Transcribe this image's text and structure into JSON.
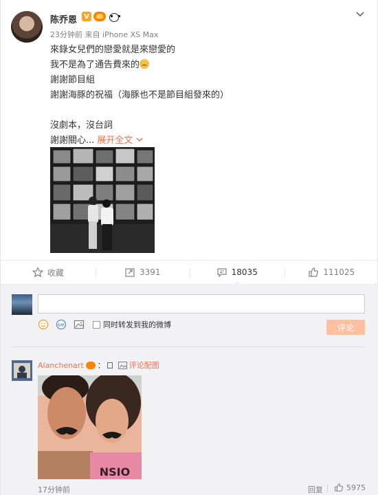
{
  "post": {
    "username": "陈乔恩",
    "verified_badge": "V",
    "timestamp": "23分钟前",
    "source_prefix": "来自",
    "source": "iPhone XS Max",
    "lines": [
      "來錄女兒們的戀愛就是來戀愛的",
      "我不是為了通告費來的",
      "謝謝節目組",
      "謝謝海豚的祝福（海豚也不是節目組發來的）",
      "",
      "沒劇本，沒台詞",
      "謝謝關心..."
    ],
    "expand_label": "展开全文",
    "icons": {
      "more": "chevron-down-icon",
      "verified": "verified-v-icon",
      "vip": "vip-crown-icon",
      "extra": "panda-icon",
      "emoji": "sad-face-emoji-icon"
    }
  },
  "actions": {
    "favorite": {
      "label": "收藏",
      "icon": "star-icon"
    },
    "repost": {
      "count": "3391",
      "icon": "repost-icon"
    },
    "comment": {
      "count": "18035",
      "icon": "comment-icon"
    },
    "like": {
      "count": "111025",
      "icon": "thumbs-up-icon"
    }
  },
  "composer": {
    "input_value": "",
    "repost_checkbox_label": "同时转发到我的微博",
    "submit_label": "评论",
    "icons": [
      "smiley-icon",
      "gif-icon",
      "image-icon"
    ]
  },
  "comment": {
    "username": "Alanchenart",
    "colon": "：",
    "image_link": "评论配图",
    "time": "17分钟前",
    "reply_label": "回复",
    "like_count": "5975"
  },
  "colors": {
    "accent": "#eb7350",
    "submit_disabled": "#ffc09f",
    "comment_bg": "#f2f2f5"
  }
}
